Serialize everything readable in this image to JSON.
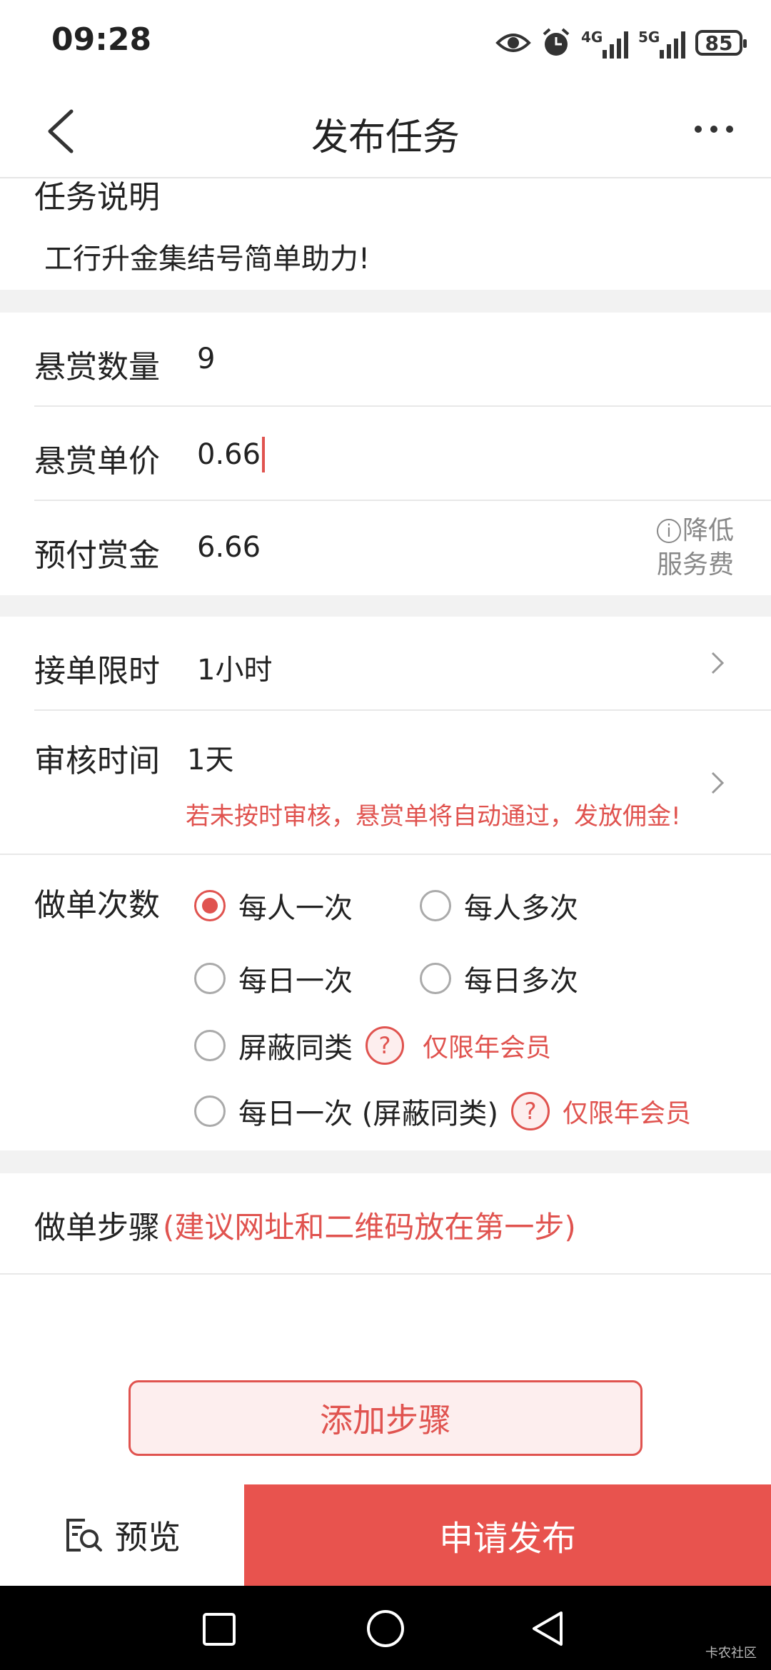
{
  "status": {
    "time": "09:28",
    "net1": "4G",
    "net2": "5G",
    "battery": "85"
  },
  "header": {
    "title": "发布任务"
  },
  "desc": {
    "label": "任务说明",
    "text": "工行升金集结号简单助力!"
  },
  "reward": {
    "count_label": "悬赏数量",
    "count_value": "9",
    "price_label": "悬赏单价",
    "price_value": "0.66",
    "prepay_label": "预付赏金",
    "prepay_value": "6.66",
    "reduce_line1": "降低",
    "reduce_line2": "服务费"
  },
  "time": {
    "limit_label": "接单限时",
    "limit_value": "1小时",
    "review_label": "审核时间",
    "review_value": "1天",
    "review_notice": "若未按时审核，悬赏单将自动通过，发放佣金!"
  },
  "frequency": {
    "label": "做单次数",
    "options": [
      {
        "label": "每人一次",
        "selected": true
      },
      {
        "label": "每人多次",
        "selected": false
      },
      {
        "label": "每日一次",
        "selected": false
      },
      {
        "label": "每日多次",
        "selected": false
      },
      {
        "label": "屏蔽同类",
        "selected": false
      },
      {
        "label": "每日一次 (屏蔽同类)",
        "selected": false
      }
    ],
    "member_only": "仅限年会员"
  },
  "steps": {
    "label": "做单步骤",
    "hint": "(建议网址和二维码放在第一步)",
    "add_label": "添加步骤"
  },
  "footer": {
    "preview_label": "预览",
    "publish_label": "申请发布"
  },
  "watermark": "卡农社区",
  "colors": {
    "accent": "#e0534f",
    "publish_bg": "#e8534e"
  }
}
